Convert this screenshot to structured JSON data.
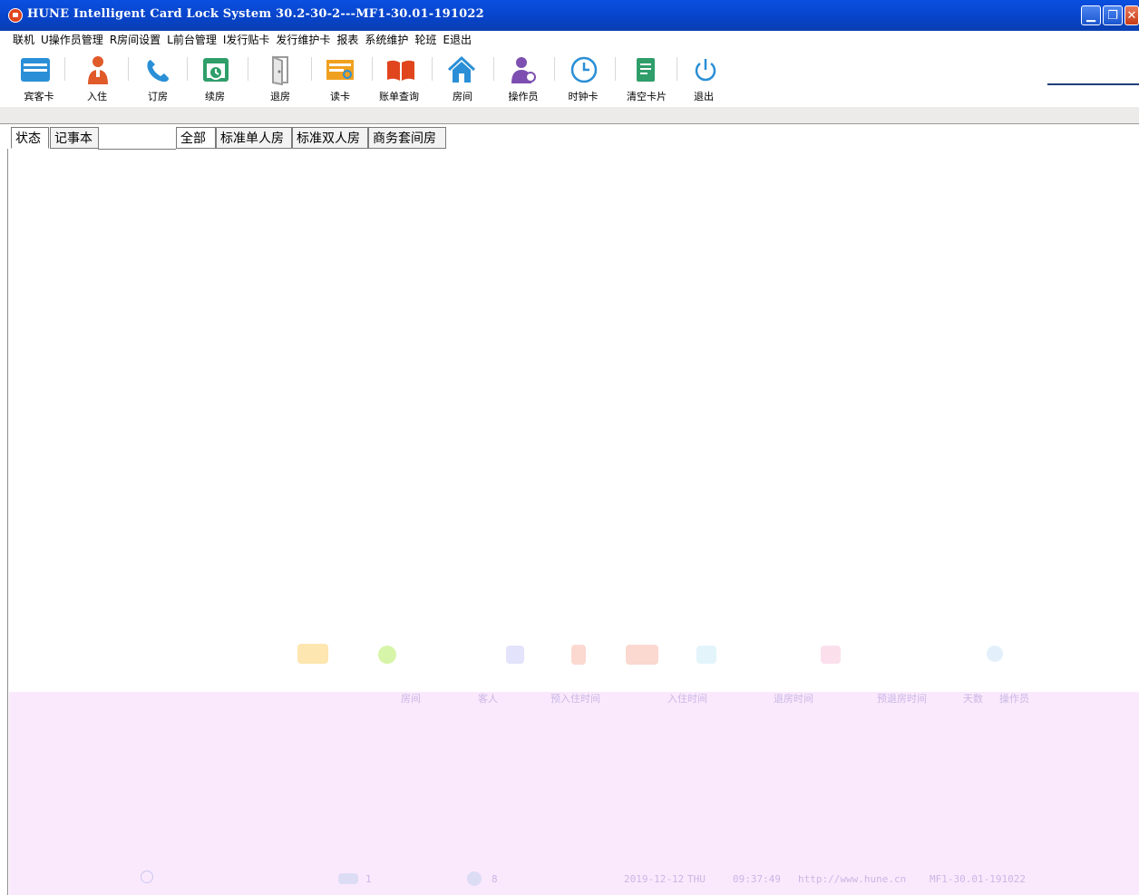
{
  "window": {
    "title": "HUNE Intelligent Card Lock System 30.2-30-2---MF1-30.01-191022"
  },
  "menu": [
    "联机",
    "U操作员管理",
    "R房间设置",
    "L前台管理",
    "I发行贴卡",
    "发行维护卡",
    "报表",
    "系统维护",
    "轮班",
    "E退出"
  ],
  "toolbar": {
    "items": [
      {
        "label": "宾客卡",
        "icon": "guest-card-icon"
      },
      {
        "label": "入住",
        "icon": "checkin-person-icon"
      },
      {
        "label": "订房",
        "icon": "phone-icon"
      },
      {
        "label": "续房",
        "icon": "renew-calendar-icon"
      },
      {
        "label": "退房",
        "icon": "door-icon"
      },
      {
        "label": "读卡",
        "icon": "read-card-icon"
      },
      {
        "label": "账单查询",
        "icon": "book-icon"
      },
      {
        "label": "房间",
        "icon": "house-icon"
      },
      {
        "label": "操作员",
        "icon": "operator-icon"
      },
      {
        "label": "时钟卡",
        "icon": "clock-icon"
      },
      {
        "label": "清空卡片",
        "icon": "clear-card-icon"
      },
      {
        "label": "退出",
        "icon": "power-icon"
      }
    ]
  },
  "left_tabs": [
    "状态",
    "记事本"
  ],
  "room_tabs": [
    "全部",
    "标准单人房",
    "标准双人房",
    "商务套间房"
  ],
  "table": {
    "headers": [
      "房间",
      "客人",
      "预入住时间",
      "入住时间",
      "退房时间",
      "预退房时间",
      "天数",
      "操作员"
    ]
  },
  "statusbar": {
    "count_a": "1",
    "count_b": "8",
    "date": "2019-12-12",
    "weekday": "THU",
    "time": "09:37:49",
    "url": "http://www.hune.cn",
    "version": "MF1-30.01-191022"
  },
  "colors": {
    "titlebar": "#0843c8",
    "accent_red": "#e0451e",
    "icon_blue": "#2a8fd6",
    "icon_green": "#2f9e6a",
    "icon_orange": "#f0a020",
    "panel_pink": "#fae9fc"
  }
}
